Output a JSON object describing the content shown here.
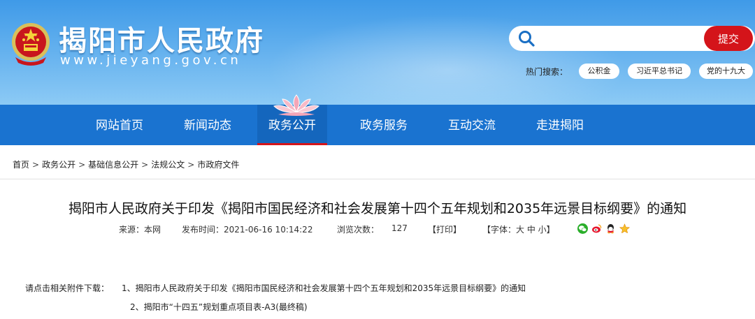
{
  "site": {
    "title": "揭阳市人民政府",
    "url": "www.jieyang.gov.cn"
  },
  "search": {
    "placeholder": "",
    "button_label": "提交"
  },
  "hot_search": {
    "label": "热门搜索：",
    "tags": [
      "公积金",
      "习近平总书记",
      "党的十九大"
    ]
  },
  "nav": {
    "items": [
      "网站首页",
      "新闻动态",
      "政务公开",
      "政务服务",
      "互动交流",
      "走进揭阳"
    ],
    "active_index": 2
  },
  "breadcrumb": [
    "首页",
    "政务公开",
    "基础信息公开",
    "法规公文",
    "市政府文件"
  ],
  "breadcrumb_sep": ">",
  "article": {
    "title": "揭阳市人民政府关于印发《揭阳市国民经济和社会发展第十四个五年规划和2035年远景目标纲要》的通知",
    "source": "来源：本网",
    "published": "发布时间：2021-06-16 10:14:22",
    "views_label": "浏览次数：",
    "views": "127",
    "print": "【打印】",
    "font_size": "【字体：大 中 小】"
  },
  "attachments": {
    "label": "请点击相关附件下载：",
    "items": [
      "1、揭阳市人民政府关于印发《揭阳市国民经济和社会发展第十四个五年规划和2035年远景目标纲要》的通知",
      "2、揭阳市“十四五”规划重点项目表-A3(最终稿)"
    ]
  },
  "share_icons": [
    "wechat-icon",
    "weibo-icon",
    "qq-icon",
    "qzone-icon"
  ],
  "colors": {
    "nav_blue": "#1a73d0",
    "accent_red": "#d4141a"
  }
}
